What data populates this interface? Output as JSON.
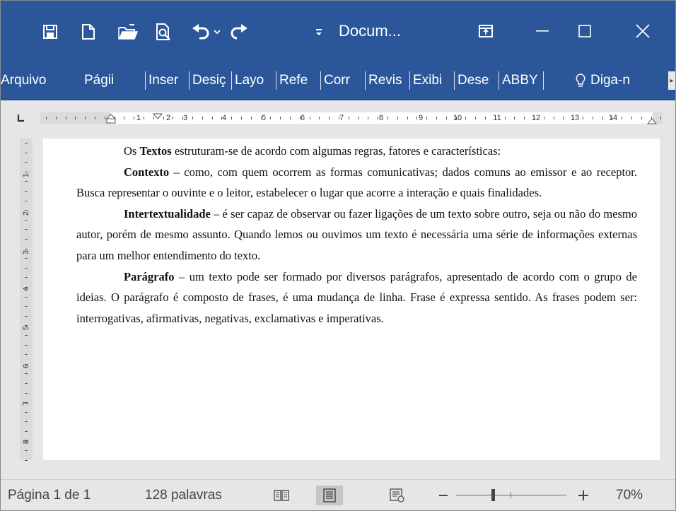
{
  "window": {
    "title": "Docum...",
    "controls": [
      "ribbon-display-options-icon",
      "minimize-icon",
      "maximize-icon",
      "close-icon"
    ]
  },
  "quick_access": {
    "icons": [
      "save-icon",
      "new-document-icon",
      "open-folder-icon",
      "print-preview-icon",
      "undo-icon",
      "undo-dropdown-icon",
      "redo-icon",
      "customize-qat-icon"
    ]
  },
  "ribbon": {
    "tabs": [
      "Arquivo",
      "Págii",
      "Inser",
      "Desiç",
      "Layo",
      "Refe",
      "Corr",
      "Revis",
      "Exibi",
      "Dese",
      "ABBY"
    ],
    "tell_me": "Diga-n"
  },
  "ruler": {
    "horizontal_numbers": [
      "1",
      "2",
      "3",
      "4",
      "5",
      "6",
      "7",
      "8",
      "9",
      "10",
      "11",
      "12",
      "13",
      "14"
    ],
    "vertical_numbers": [
      "1",
      "2",
      "3",
      "4",
      "5",
      "6",
      "7",
      "8"
    ]
  },
  "document": {
    "paragraphs": [
      {
        "bold": "",
        "before": "Os ",
        "strong": "Textos",
        "text": " estruturam-se de acordo com algumas regras, fatores e características:"
      },
      {
        "before": "",
        "strong": "Contexto",
        "text": " – como, com quem ocorrem as formas comunicativas; dados comuns ao emissor e ao receptor. Busca representar o ouvinte e o leitor, estabelecer o lugar que acorre a interação e quais finalidades."
      },
      {
        "before": "",
        "strong": "Intertextualidade",
        "text": " – é ser capaz de observar ou fazer ligações de um texto sobre outro, seja ou não do mesmo autor, porém de mesmo assunto. Quando lemos ou ouvimos um texto é necessária uma série de informações externas para um melhor entendimento do texto."
      },
      {
        "before": "",
        "strong": "Parágrafo",
        "text": " – um texto pode ser formado por diversos parágrafos, apresentado de acordo com o grupo de ideias. O parágrafo é composto de frases, é uma mudança de linha. Frase é expressa sentido. As frases podem ser: interrogativas, afirmativas, negativas, exclamativas e imperativas."
      }
    ]
  },
  "status": {
    "page": "Página 1 de 1",
    "words": "128 palavras",
    "zoom": "70%",
    "zoom_level": 0.7,
    "active_view": "print-layout"
  },
  "colors": {
    "accent": "#2b579a",
    "chrome_bg": "#e6e6e6",
    "page_bg": "#ffffff"
  }
}
